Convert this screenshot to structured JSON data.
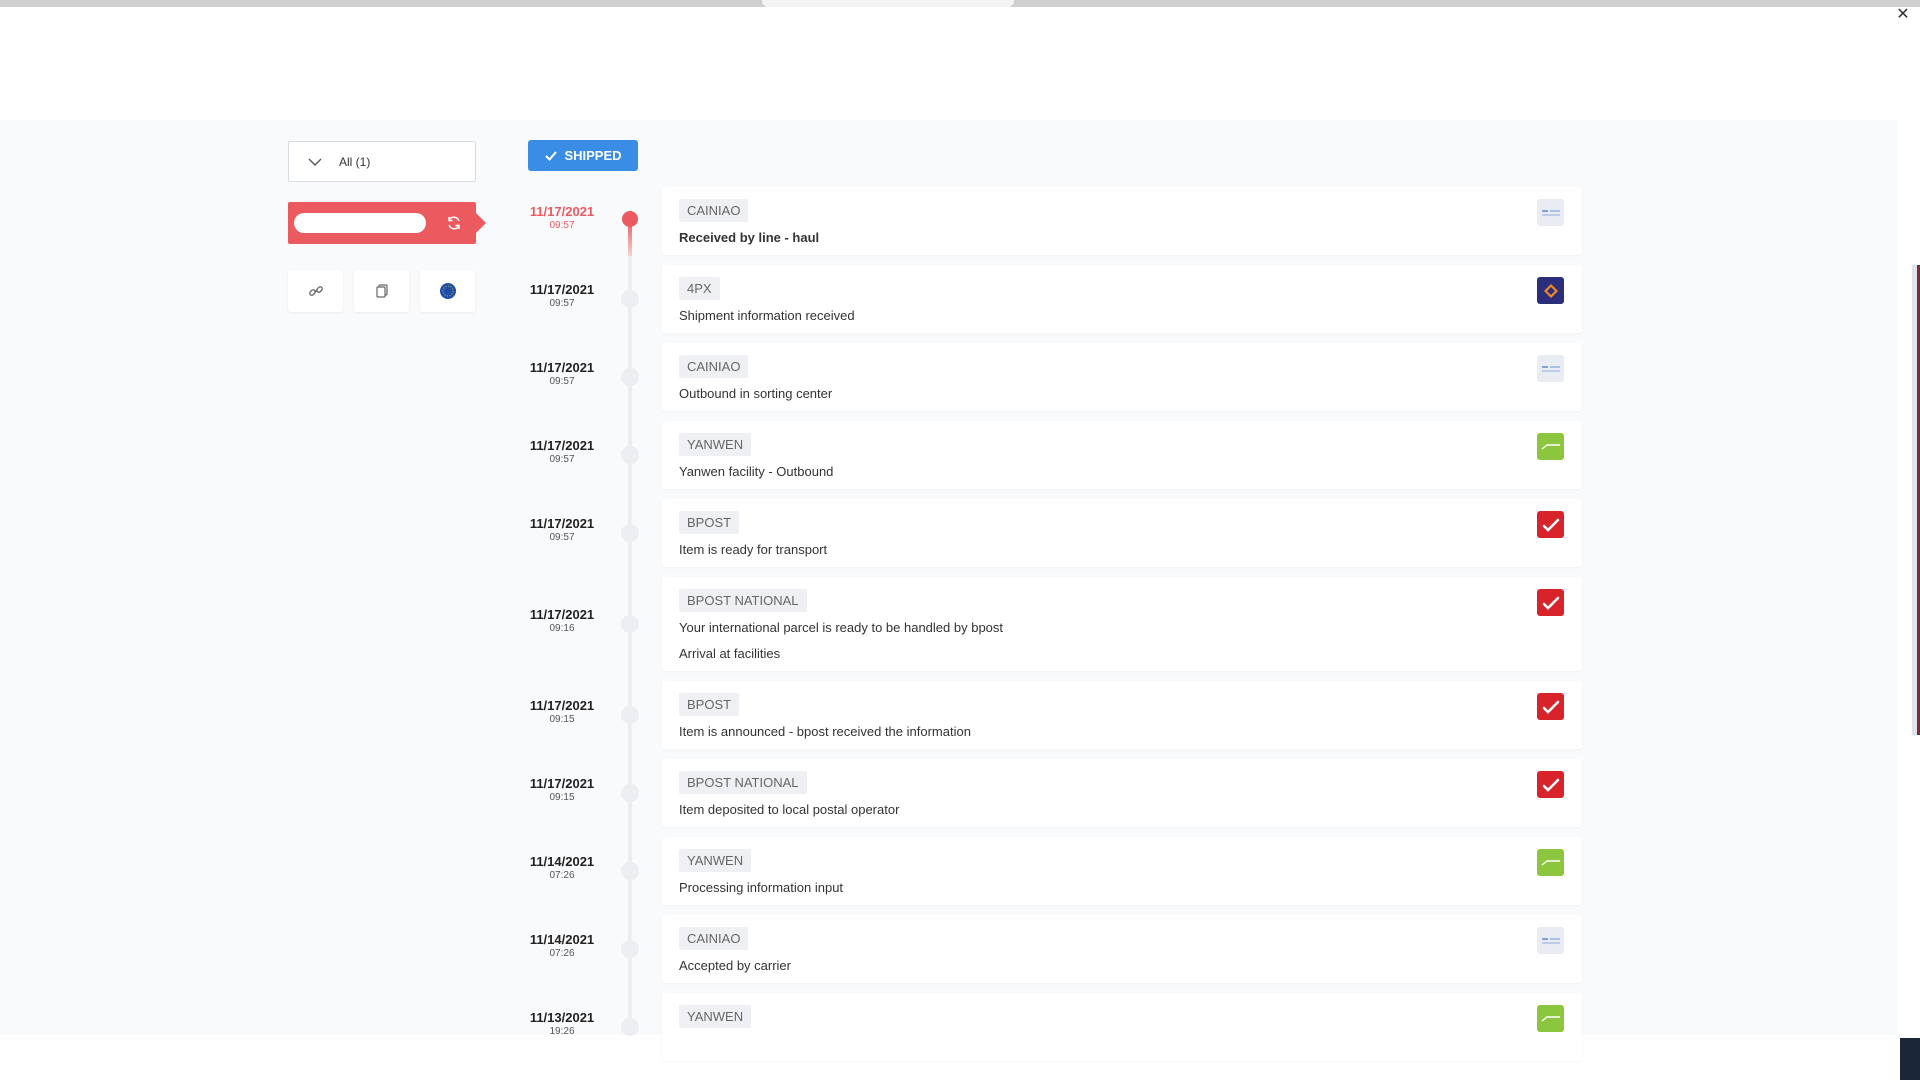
{
  "filter": {
    "label": "All (1)"
  },
  "status": {
    "label": "SHIPPED"
  },
  "colors": {
    "accent": "#3a8de4",
    "danger": "#ea5a5f",
    "bpost": "#d8232a",
    "yanwen": "#8cc63f",
    "fourpx": "#2b2e7a",
    "cainiao": "#e9edf3"
  },
  "events": [
    {
      "date": "11/17/2021",
      "time": "09:57",
      "carrier": "CAINIAO",
      "lines": [
        "Received by line - haul"
      ],
      "logo": "cainiao-logo-icon"
    },
    {
      "date": "11/17/2021",
      "time": "09:57",
      "carrier": "4PX",
      "lines": [
        "Shipment information received"
      ],
      "logo": "fourpx-logo-icon"
    },
    {
      "date": "11/17/2021",
      "time": "09:57",
      "carrier": "CAINIAO",
      "lines": [
        "Outbound in sorting center"
      ],
      "logo": "cainiao-logo-icon"
    },
    {
      "date": "11/17/2021",
      "time": "09:57",
      "carrier": "YANWEN",
      "lines": [
        "Yanwen facility - Outbound"
      ],
      "logo": "yanwen-logo-icon"
    },
    {
      "date": "11/17/2021",
      "time": "09:57",
      "carrier": "BPOST",
      "lines": [
        "Item is ready for transport"
      ],
      "logo": "bpost-logo-icon"
    },
    {
      "date": "11/17/2021",
      "time": "09:16",
      "carrier": "BPOST NATIONAL",
      "lines": [
        "Your international parcel is ready to be handled by bpost",
        "Arrival at facilities"
      ],
      "logo": "bpost-logo-icon"
    },
    {
      "date": "11/17/2021",
      "time": "09:15",
      "carrier": "BPOST",
      "lines": [
        "Item is announced - bpost received the information"
      ],
      "logo": "bpost-logo-icon"
    },
    {
      "date": "11/17/2021",
      "time": "09:15",
      "carrier": "BPOST NATIONAL",
      "lines": [
        "Item deposited to local postal operator"
      ],
      "logo": "bpost-logo-icon"
    },
    {
      "date": "11/14/2021",
      "time": "07:26",
      "carrier": "YANWEN",
      "lines": [
        "Processing information input"
      ],
      "logo": "yanwen-logo-icon"
    },
    {
      "date": "11/14/2021",
      "time": "07:26",
      "carrier": "CAINIAO",
      "lines": [
        "Accepted by carrier"
      ],
      "logo": "cainiao-logo-icon"
    },
    {
      "date": "11/13/2021",
      "time": "19:26",
      "carrier": "YANWEN",
      "lines": [],
      "logo": "yanwen-logo-icon"
    }
  ]
}
